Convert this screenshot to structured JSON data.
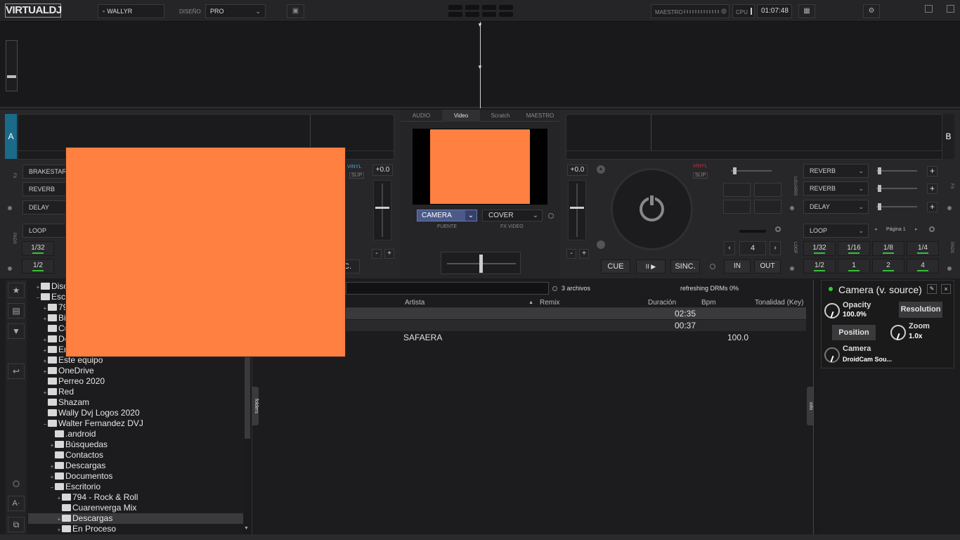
{
  "topbar": {
    "logo": "VIRTUALDJ",
    "user": "WALLYR",
    "design_label": "DISEÑO",
    "design_value": "PRO",
    "master_label": "MAESTRO",
    "cpu_label": "CPU",
    "clock": "01:07:48"
  },
  "deck_left": {
    "letter": "A",
    "fx_tag": "FX",
    "pads_tag": "PADS",
    "fx_slots": [
      "BRAKESTART",
      "REVERB",
      "DELAY"
    ],
    "pad_mode": "LOOP",
    "pads": [
      "1/32",
      "1/2"
    ],
    "pitch": "+0.0",
    "vinyl": "VINYL",
    "slip": "SLIP",
    "sync_partial": "C."
  },
  "center": {
    "tabs": [
      "AUDIO",
      "Video",
      "Scratch",
      "MAESTRO"
    ],
    "active_tab": "Video",
    "source_value": "CAMERA",
    "source_label": "FUENTE",
    "fx_value": "COVER",
    "fx_label": "FX VIDEO",
    "preview_color": "#ff8040"
  },
  "deck_right": {
    "letter": "B",
    "pitch": "+0.0",
    "vinyl": "VINYL",
    "slip": "SLIP",
    "cue": "CUE",
    "play": "II ▶",
    "sync": "SINC.",
    "user_tag": "USUARIO",
    "fx_tag": "FX",
    "loop_tag": "LOOP",
    "pads_tag": "PADS",
    "fx_slots": [
      "REVERB",
      "REVERB",
      "DELAY"
    ],
    "pad_mode": "LOOP",
    "page_label": "Página 1",
    "loop_value": "4",
    "loop_in": "IN",
    "loop_out": "OUT",
    "pads_row1": [
      "1/32",
      "1/16",
      "1/8",
      "1/4"
    ],
    "pads_row2": [
      "1/2",
      "1",
      "2",
      "4"
    ]
  },
  "tree": {
    "items": [
      {
        "label": "Disc",
        "indent": 0,
        "plus": "+"
      },
      {
        "label": "Esc",
        "indent": 0,
        "plus": "−"
      },
      {
        "label": "79",
        "indent": 1,
        "plus": "+"
      },
      {
        "label": "Bi",
        "indent": 1,
        "plus": "+"
      },
      {
        "label": "Cu",
        "indent": 1,
        "plus": ""
      },
      {
        "label": "De",
        "indent": 1,
        "plus": "+"
      },
      {
        "label": "En",
        "indent": 1,
        "plus": "+"
      },
      {
        "label": "Este equipo",
        "indent": 1,
        "plus": "+"
      },
      {
        "label": "OneDrive",
        "indent": 1,
        "plus": "+"
      },
      {
        "label": "Perreo 2020",
        "indent": 1,
        "plus": ""
      },
      {
        "label": "Red",
        "indent": 1,
        "plus": "+"
      },
      {
        "label": "Shazam",
        "indent": 1,
        "plus": ""
      },
      {
        "label": "Wally Dvj Logos 2020",
        "indent": 1,
        "plus": ""
      },
      {
        "label": "Walter Fernandez DVJ",
        "indent": 1,
        "plus": "−"
      },
      {
        "label": ".android",
        "indent": 2,
        "plus": ""
      },
      {
        "label": "Búsquedas",
        "indent": 2,
        "plus": "+"
      },
      {
        "label": "Contactos",
        "indent": 2,
        "plus": ""
      },
      {
        "label": "Descargas",
        "indent": 2,
        "plus": "+"
      },
      {
        "label": "Documentos",
        "indent": 2,
        "plus": "+"
      },
      {
        "label": "Escritorio",
        "indent": 2,
        "plus": "−"
      },
      {
        "label": "794 - Rock & Roll",
        "indent": 3,
        "plus": "+"
      },
      {
        "label": "Cuarenverga Mix",
        "indent": 3,
        "plus": ""
      },
      {
        "label": "Descargas",
        "indent": 3,
        "plus": "+",
        "selected": true
      },
      {
        "label": "En Proceso",
        "indent": 3,
        "plus": "+"
      }
    ]
  },
  "filelist": {
    "count": "3 archivos",
    "status": "refreshing DRMs 0%",
    "folders_tab": "folders",
    "info_tab": "info",
    "columns": [
      "Artista",
      "Remix",
      "Duración",
      "Bpm",
      "Tonalidad (Key)"
    ],
    "rows": [
      {
        "artist": "",
        "duration": "02:35",
        "bpm": ""
      },
      {
        "artist": "",
        "duration": "00:37",
        "bpm": ""
      },
      {
        "artist": "SAFAERA",
        "duration": "",
        "bpm": "100.0"
      }
    ]
  },
  "camera_panel": {
    "title": "Camera (v. source)",
    "opacity_label": "Opacity",
    "opacity_value": "100.0%",
    "resolution": "Resolution",
    "position": "Position",
    "zoom_label": "Zoom",
    "zoom_value": "1.0x",
    "camera_label": "Camera",
    "camera_value": "DroidCam Sou..."
  },
  "overlay_color": "#ff8040"
}
